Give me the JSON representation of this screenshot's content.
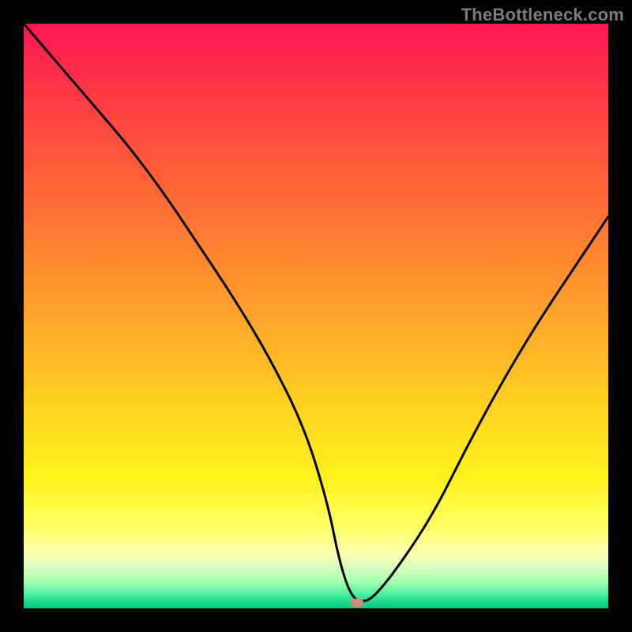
{
  "watermark": "TheBottleneck.com",
  "colors": {
    "background_frame": "#000000",
    "curve": "#000000",
    "marker": "#d08878",
    "gradient_stops": [
      {
        "offset": 0.0,
        "color": "#ff1654"
      },
      {
        "offset": 0.07,
        "color": "#ff2a4a"
      },
      {
        "offset": 0.18,
        "color": "#ff4a3e"
      },
      {
        "offset": 0.3,
        "color": "#ff6b35"
      },
      {
        "offset": 0.42,
        "color": "#ff8c2e"
      },
      {
        "offset": 0.55,
        "color": "#ffb327"
      },
      {
        "offset": 0.68,
        "color": "#ffd91f"
      },
      {
        "offset": 0.78,
        "color": "#fff31a"
      },
      {
        "offset": 0.86,
        "color": "#ffff66"
      },
      {
        "offset": 0.905,
        "color": "#ffffb0"
      },
      {
        "offset": 0.93,
        "color": "#d8ffc0"
      },
      {
        "offset": 0.955,
        "color": "#a0ffb0"
      },
      {
        "offset": 0.975,
        "color": "#50f0a0"
      },
      {
        "offset": 0.99,
        "color": "#18d888"
      },
      {
        "offset": 1.0,
        "color": "#00c878"
      }
    ]
  },
  "chart_data": {
    "type": "line",
    "title": "",
    "xlabel": "",
    "ylabel": "",
    "xlim": [
      0,
      100
    ],
    "ylim": [
      0,
      100
    ],
    "grid": false,
    "legend": false,
    "marker_point": {
      "x": 57,
      "y": 1
    },
    "series": [
      {
        "name": "curve",
        "x": [
          0,
          6,
          12,
          18,
          24,
          30,
          36,
          42,
          48,
          52,
          54,
          56,
          58,
          60,
          64,
          70,
          76,
          82,
          88,
          94,
          100
        ],
        "values": [
          100,
          93,
          86,
          79,
          71,
          62,
          53,
          43,
          31,
          18,
          8,
          2,
          1,
          2,
          7,
          16,
          28,
          39,
          49,
          58,
          67
        ]
      }
    ]
  }
}
